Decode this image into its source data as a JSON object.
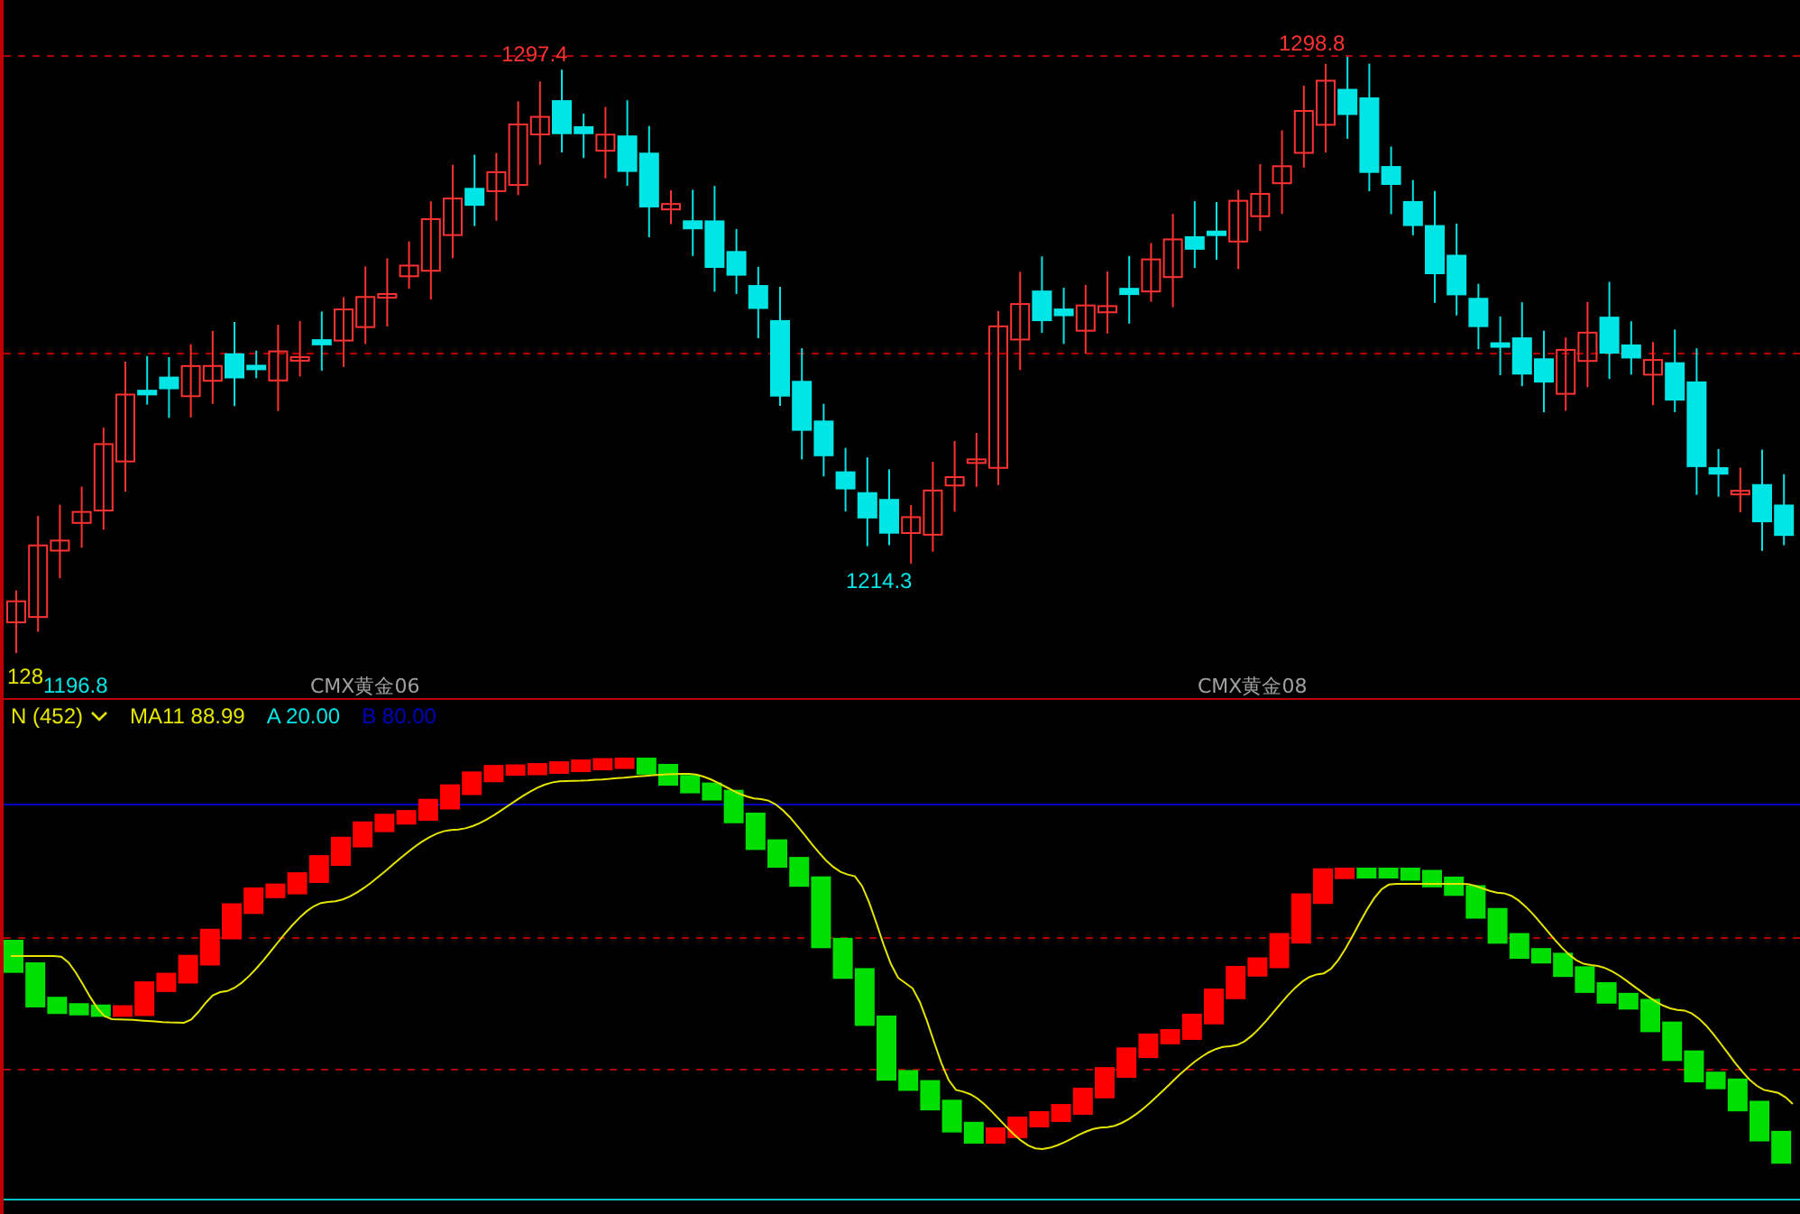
{
  "price_chart": {
    "price_labels": [
      {
        "text": "1297.4",
        "color": "#ff3232"
      },
      {
        "text": "1298.8",
        "color": "#ff3232"
      },
      {
        "text": "1214.3",
        "color": "#00e5e5"
      },
      {
        "text": "1196.8",
        "color": "#00e5e5"
      },
      {
        "text": "128",
        "color": "#e5e500"
      }
    ],
    "axis_labels": [
      "CMX黄金06",
      "CMX黄金08"
    ]
  },
  "indicator": {
    "name": "N (452)",
    "legend": [
      {
        "text": "MA11 88.99",
        "color": "#e5e500"
      },
      {
        "text": "A 20.00",
        "color": "#00e5e5"
      },
      {
        "text": "B 80.00",
        "color": "#0000c0"
      }
    ]
  }
}
